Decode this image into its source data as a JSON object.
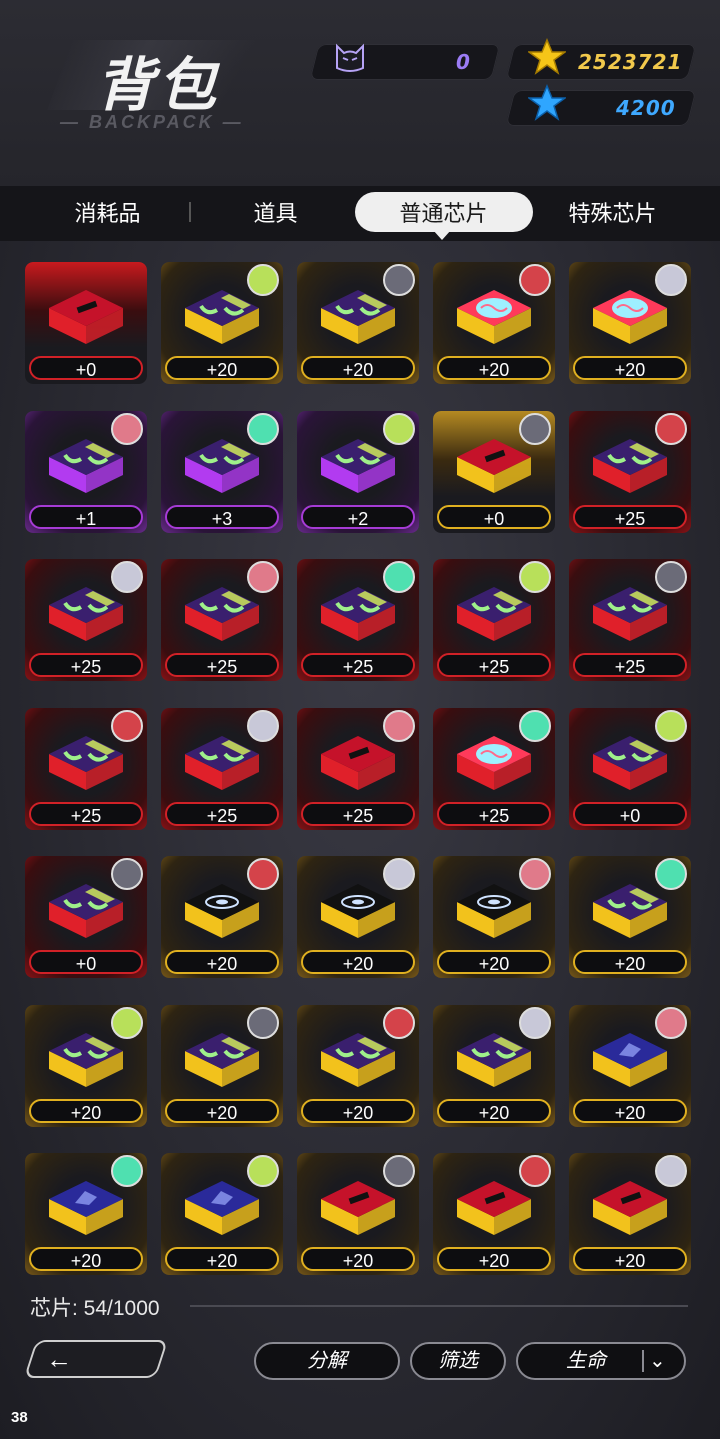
{
  "header": {
    "title": "背包",
    "subtitle": "— BACKPACK —",
    "currency": [
      {
        "icon": "cat-face-icon",
        "value": "0",
        "color": "#9b7cf5"
      },
      {
        "icon": "gold-star-icon",
        "value": "2523721",
        "color": "#f2c94c"
      },
      {
        "icon": "blue-star-icon",
        "value": "4200",
        "color": "#3fa9ff"
      }
    ]
  },
  "tabs": [
    {
      "label": "消耗品"
    },
    {
      "label": "道具"
    },
    {
      "label": "普通芯片"
    },
    {
      "label": "特殊芯片"
    }
  ],
  "active_tab": "普通芯片",
  "chips": [
    {
      "level": "+0",
      "rarity": "redtop",
      "chip": "red-cartridge"
    },
    {
      "level": "+20",
      "rarity": "gold",
      "chip": "green-pattern"
    },
    {
      "level": "+20",
      "rarity": "gold",
      "chip": "green-pattern"
    },
    {
      "level": "+20",
      "rarity": "gold",
      "chip": "brain"
    },
    {
      "level": "+20",
      "rarity": "gold",
      "chip": "brain"
    },
    {
      "level": "+1",
      "rarity": "purple",
      "chip": "green-pattern"
    },
    {
      "level": "+3",
      "rarity": "purple",
      "chip": "green-pattern"
    },
    {
      "level": "+2",
      "rarity": "purple",
      "chip": "green-pattern"
    },
    {
      "level": "+0",
      "rarity": "goldtop",
      "chip": "red-cartridge"
    },
    {
      "level": "+25",
      "rarity": "red",
      "chip": "green-pattern"
    },
    {
      "level": "+25",
      "rarity": "red",
      "chip": "green-pattern"
    },
    {
      "level": "+25",
      "rarity": "red",
      "chip": "green-pattern"
    },
    {
      "level": "+25",
      "rarity": "red",
      "chip": "green-pattern"
    },
    {
      "level": "+25",
      "rarity": "red",
      "chip": "green-pattern"
    },
    {
      "level": "+25",
      "rarity": "red",
      "chip": "green-pattern"
    },
    {
      "level": "+25",
      "rarity": "red",
      "chip": "green-pattern"
    },
    {
      "level": "+25",
      "rarity": "red",
      "chip": "green-pattern"
    },
    {
      "level": "+25",
      "rarity": "red",
      "chip": "red-cartridge"
    },
    {
      "level": "+25",
      "rarity": "red",
      "chip": "brain"
    },
    {
      "level": "+0",
      "rarity": "red",
      "chip": "green-pattern"
    },
    {
      "level": "+0",
      "rarity": "red",
      "chip": "green-pattern"
    },
    {
      "level": "+20",
      "rarity": "gold",
      "chip": "vortex"
    },
    {
      "level": "+20",
      "rarity": "gold",
      "chip": "vortex"
    },
    {
      "level": "+20",
      "rarity": "gold",
      "chip": "vortex"
    },
    {
      "level": "+20",
      "rarity": "gold",
      "chip": "green-pattern"
    },
    {
      "level": "+20",
      "rarity": "gold",
      "chip": "green-pattern"
    },
    {
      "level": "+20",
      "rarity": "gold",
      "chip": "green-pattern"
    },
    {
      "level": "+20",
      "rarity": "gold",
      "chip": "green-pattern"
    },
    {
      "level": "+20",
      "rarity": "gold",
      "chip": "green-pattern"
    },
    {
      "level": "+20",
      "rarity": "gold",
      "chip": "blue-logo"
    },
    {
      "level": "+20",
      "rarity": "gold",
      "chip": "blue-logo"
    },
    {
      "level": "+20",
      "rarity": "gold",
      "chip": "blue-logo"
    },
    {
      "level": "+20",
      "rarity": "gold",
      "chip": "red-cartridge"
    },
    {
      "level": "+20",
      "rarity": "gold",
      "chip": "red-cartridge"
    },
    {
      "level": "+20",
      "rarity": "gold",
      "chip": "red-cartridge"
    }
  ],
  "footer": {
    "chip_count_label": "芯片: 54/1000",
    "back_icon": "arrow-left-icon",
    "decompose_label": "分解",
    "filter_label": "筛选",
    "sort_value": "生命",
    "fps": "38"
  }
}
